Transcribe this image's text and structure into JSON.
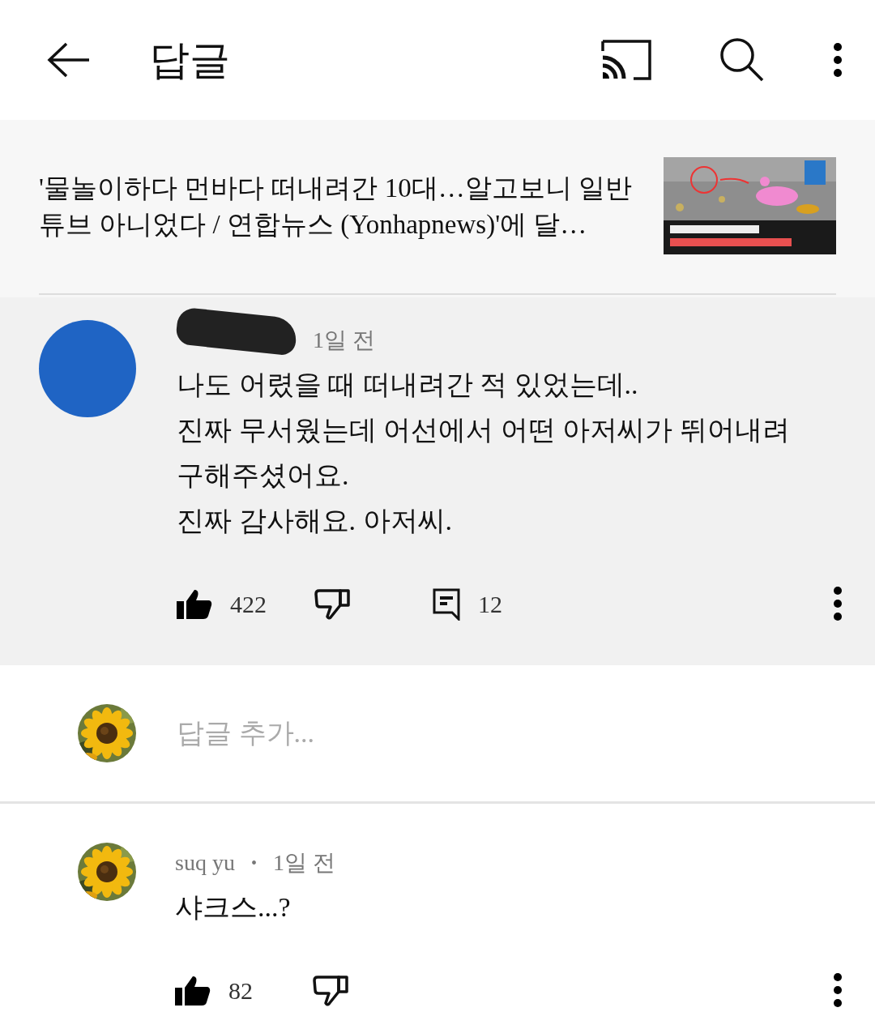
{
  "header": {
    "title": "답글"
  },
  "video": {
    "title": "'물놀이하다 먼바다 떠내려간 10대…알고보니 일반 튜브 아니었다 / 연합뉴스 (Yonhapnews)'에 달…"
  },
  "comments": [
    {
      "highlighted": true,
      "avatar": {
        "kind": "plain"
      },
      "redacted": true,
      "date": "1일 전",
      "body": "나도 어렸을 때 떠내려간 적 있었는데..\n진짜 무서웠는데 어선에서 어떤 아저씨가 뛰어내려\n구해주셨어요.\n진짜 감사해요. 아저씨.",
      "likes": "422",
      "replies": "12"
    },
    {
      "highlighted": false,
      "redacted": false,
      "author": "suq yu",
      "separator": "•",
      "date": "1일 전",
      "body": "샤크스...?",
      "likes": "82"
    }
  ],
  "reply_box": {
    "placeholder": "답글 추가..."
  }
}
